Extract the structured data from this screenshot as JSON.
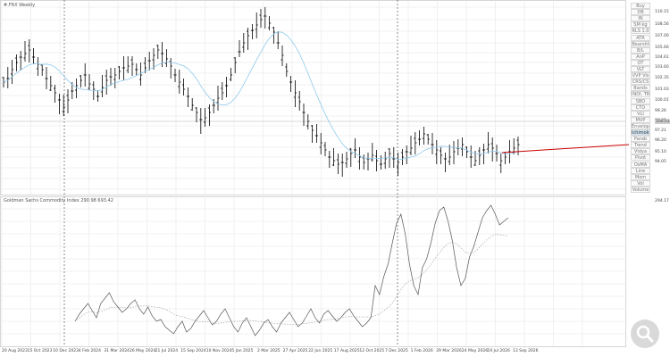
{
  "main_chart": {
    "title": "#.FRX Weekly"
  },
  "indicator": {
    "title": "Goldman Sachs Commodity Index 290.98 693.42"
  },
  "price_scale": [
    "110.15",
    "108.56",
    "107.00",
    "105.66",
    "104.61",
    "103.60",
    "102.35",
    "101.03",
    "100.01",
    "99.26",
    "98.25",
    "97.21",
    "96.20",
    "95.10",
    "94.05"
  ],
  "price_highlight": [
    "100.01",
    "100.01"
  ],
  "indicator_scale": [
    "294.17"
  ],
  "time_axis": [
    "20 Aug 2023",
    "15 Oct 2023",
    "10 Dec 2023",
    "4 Feb 2024",
    "31 Mar 2024",
    "26 May 2024",
    "21 Jul 2024",
    "15 Sep 2024",
    "10 Nov 2024",
    "5 Jan 2025",
    "2 Mar 2025",
    "27 Apr 2025",
    "22 Jun 2025",
    "17 Aug 2025",
    "12 Oct 2025",
    "7 Dec 2025",
    "1 Feb 2026",
    "29 Mar 2026",
    "24 May 2026",
    "19 Jul 2026",
    "13 Sep 2026"
  ],
  "right_panel": {
    "buttons": [
      "Buy",
      "DB",
      "IN",
      "SM kg",
      "RLS 1.0",
      "ATR",
      "Bearsht",
      "B/L",
      "AnP",
      "OT",
      "VLT",
      "VVP Vis",
      "CRS/CS",
      "Bands",
      "INDI. TRACK",
      "SBO",
      "CTO",
      "VLI",
      "MVP",
      "Envelop",
      "Ichimoku",
      "Parab",
      "Trend",
      "Vidya",
      "Pivot",
      "OsMA",
      "Line",
      "Mom",
      "Vol",
      "Volume"
    ],
    "active_index": 20
  },
  "zoom_icon": "magnifier-icon",
  "colors": {
    "ma_line": "#8ec9ec",
    "trend_line": "#cc0000",
    "grid": "#e6e6e6",
    "candle": "#000000"
  }
}
